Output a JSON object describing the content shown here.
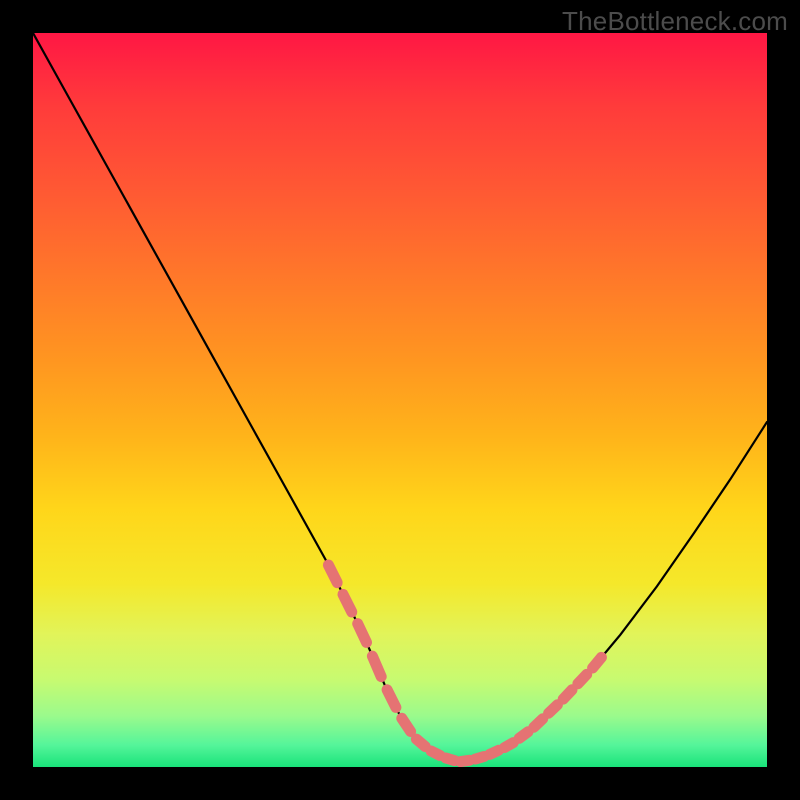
{
  "watermark": "TheBottleneck.com",
  "colors": {
    "page_bg": "#000000",
    "curve": "#000000",
    "highlight": "#e57373",
    "gradient_top": "#ff1744",
    "gradient_bottom": "#19e37a"
  },
  "chart_data": {
    "type": "line",
    "title": "",
    "xlabel": "",
    "ylabel": "",
    "xlim": [
      0,
      100
    ],
    "ylim": [
      0,
      100
    ],
    "grid": false,
    "series": [
      {
        "name": "bottleneck-curve-left",
        "x": [
          0,
          5,
          10,
          15,
          20,
          25,
          30,
          35,
          40,
          45,
          48,
          50,
          52,
          54,
          56,
          58
        ],
        "values": [
          100,
          91,
          82,
          73,
          64,
          55,
          46,
          37,
          28,
          18,
          11,
          7,
          4,
          2.3,
          1.3,
          0.7
        ]
      },
      {
        "name": "bottleneck-curve-right",
        "x": [
          58,
          60,
          62,
          65,
          68,
          72,
          76,
          80,
          85,
          90,
          95,
          100
        ],
        "values": [
          0.7,
          1.0,
          1.6,
          3.0,
          5.2,
          9.0,
          13.2,
          18.0,
          24.6,
          31.8,
          39.2,
          47.0
        ]
      }
    ],
    "highlight_segments": [
      {
        "x_start": 40,
        "x_end": 48,
        "side": "left"
      },
      {
        "x_start": 48,
        "x_end": 68,
        "side": "bottom"
      },
      {
        "x_start": 68,
        "x_end": 78,
        "side": "right"
      }
    ]
  }
}
